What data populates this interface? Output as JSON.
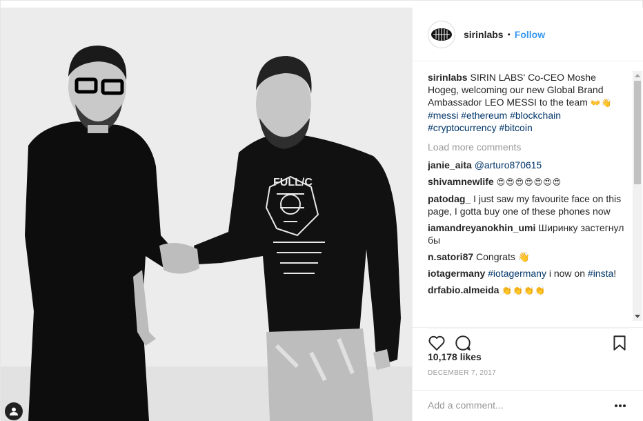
{
  "post": {
    "username": "sirinlabs",
    "follow_label": "Follow",
    "separator": "•"
  },
  "caption": {
    "username": "sirinlabs",
    "text": "SIRIN LABS' Co-CEO Moshe Hogeg, welcoming our new Global Brand Ambassador LEO MESSI to the team",
    "emoji": "👐👋",
    "hashtags": [
      "#messi",
      "#ethereum",
      "#blockchain",
      "#cryptocurrency",
      "#bitcoin"
    ]
  },
  "load_more_label": "Load more comments",
  "comments": [
    {
      "user": "janie_aita",
      "text": "",
      "mention": "@arturo870615"
    },
    {
      "user": "shivamnewlife",
      "text": "😍😍😍😍😍😍😍",
      "mention": ""
    },
    {
      "user": "patodag_",
      "text": "I just saw my favourite face on this page, I gotta buy one of these phones now",
      "mention": ""
    },
    {
      "user": "iamandreyanokhin_umi",
      "text": "Ширинку застегнул бы",
      "mention": ""
    },
    {
      "user": "n.satori87",
      "text": "Congrats 👋",
      "mention": ""
    },
    {
      "user": "iotagermany",
      "text": "i now on",
      "mention": "#iotagermany",
      "mention2": "#insta",
      "tail": "!"
    },
    {
      "user": "drfabio.almeida",
      "text": "👏👏👏👏",
      "mention": ""
    }
  ],
  "likes_label": "10,178 likes",
  "date_label": "DECEMBER 7, 2017",
  "add_comment_placeholder": "Add a comment...",
  "icons": {
    "like": "heart-icon",
    "comment": "comment-icon",
    "save": "bookmark-icon",
    "more": "more-options-icon",
    "tag": "user-tag-icon"
  },
  "colors": {
    "link": "#3897f0",
    "hashtag": "#003569",
    "muted": "#999999",
    "text": "#262626"
  }
}
